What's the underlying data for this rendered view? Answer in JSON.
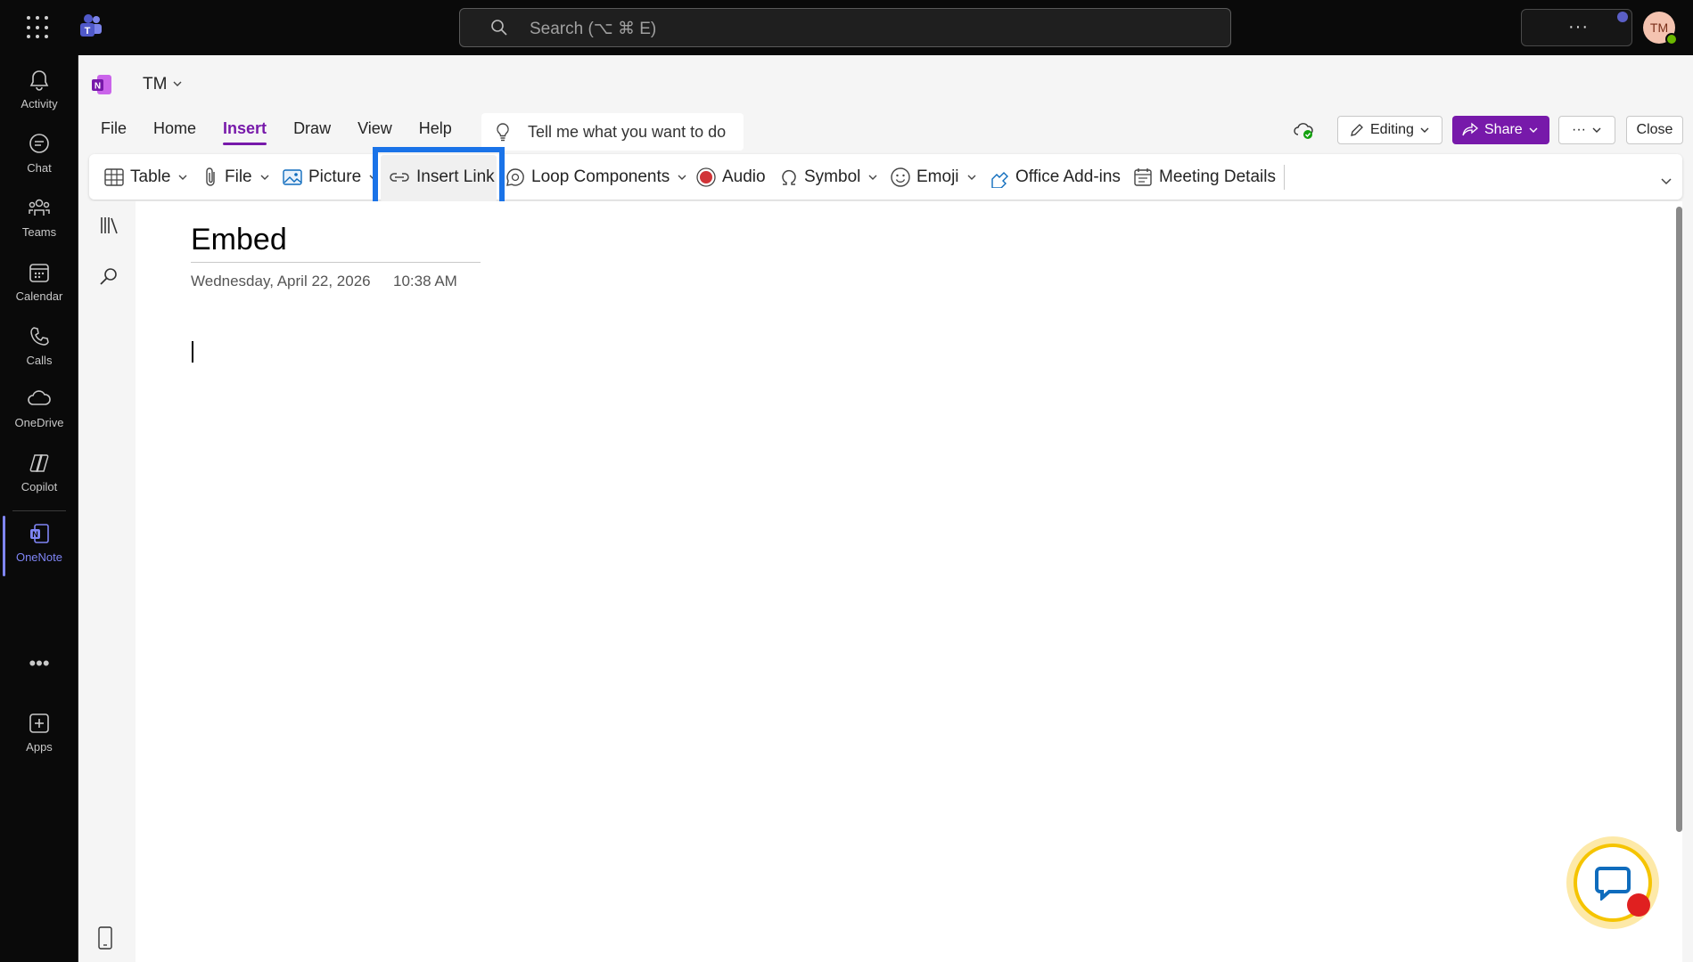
{
  "topbar": {
    "search_placeholder": "Search (⌥ ⌘ E)",
    "more_label": "···",
    "avatar_initials": "TM"
  },
  "rail": {
    "items": [
      {
        "label": "Activity",
        "icon": "bell-icon"
      },
      {
        "label": "Chat",
        "icon": "chat-icon"
      },
      {
        "label": "Teams",
        "icon": "teams-icon"
      },
      {
        "label": "Calendar",
        "icon": "calendar-icon"
      },
      {
        "label": "Calls",
        "icon": "phone-icon"
      },
      {
        "label": "OneDrive",
        "icon": "cloud-icon"
      },
      {
        "label": "Copilot",
        "icon": "copilot-icon"
      },
      {
        "label": "OneNote",
        "icon": "onenote-icon",
        "active": true
      },
      {
        "label": "Apps",
        "icon": "plus-square-icon"
      }
    ],
    "more": "•••"
  },
  "header": {
    "notebook": "TM",
    "tabs": [
      "File",
      "Home",
      "Insert",
      "Draw",
      "View",
      "Help"
    ],
    "active_tab": "Insert",
    "tellme": "Tell me what you want to do",
    "editing": "Editing",
    "share": "Share",
    "more": "···",
    "close": "Close"
  },
  "ribbon": {
    "table": "Table",
    "file": "File",
    "picture": "Picture",
    "insert_link": "Insert Link",
    "loop": "Loop Components",
    "audio": "Audio",
    "symbol": "Symbol",
    "emoji": "Emoji",
    "addins": "Office Add-ins",
    "meeting": "Meeting Details"
  },
  "page": {
    "title": "Embed",
    "date": "Wednesday, April 22, 2026",
    "time": "10:38 AM"
  },
  "colors": {
    "accent_purple": "#7719aa",
    "teams_accent": "#7f85f5",
    "highlight_blue": "#1a73e8"
  }
}
